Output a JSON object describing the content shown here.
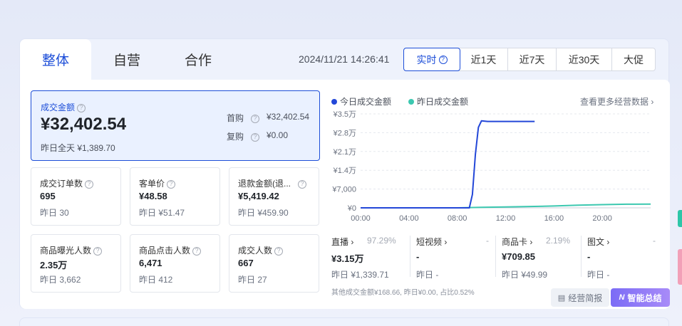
{
  "tabs": [
    {
      "label": "整体",
      "active": true
    },
    {
      "label": "自营",
      "active": false
    },
    {
      "label": "合作",
      "active": false
    }
  ],
  "datetime": "2024/11/21 14:26:41",
  "ranges": [
    {
      "label": "实时",
      "active": true,
      "help": true
    },
    {
      "label": "近1天"
    },
    {
      "label": "近7天"
    },
    {
      "label": "近30天"
    },
    {
      "label": "大促"
    }
  ],
  "main_card": {
    "title": "成交金额",
    "value": "¥32,402.54",
    "yesterday": "昨日全天 ¥1,389.70",
    "first_label": "首购",
    "first_value": "¥32,402.54",
    "repeat_label": "复购",
    "repeat_value": "¥0.00"
  },
  "cards": [
    {
      "title": "成交订单数",
      "value": "695",
      "yesterday": "昨日 30"
    },
    {
      "title": "客单价",
      "value": "¥48.58",
      "yesterday": "昨日 ¥51.47"
    },
    {
      "title": "退款金额(退...",
      "value": "¥5,419.42",
      "yesterday": "昨日 ¥459.90"
    },
    {
      "title": "商品曝光人数",
      "value": "2.35万",
      "yesterday": "昨日 3,662"
    },
    {
      "title": "商品点击人数",
      "value": "6,471",
      "yesterday": "昨日 412"
    },
    {
      "title": "成交人数",
      "value": "667",
      "yesterday": "昨日 27"
    }
  ],
  "legend": {
    "today": "今日成交金额",
    "yesterday": "昨日成交金额"
  },
  "more_link": "查看更多经营数据 ›",
  "colors": {
    "primary": "#1d4ed8",
    "today_line": "#2347d8",
    "yesterday_line": "#3cc8b0",
    "ai_button": "#8b78f7"
  },
  "chart_data": {
    "type": "line",
    "x_ticks": [
      "00:00",
      "04:00",
      "08:00",
      "12:00",
      "16:00",
      "20:00"
    ],
    "y_ticks": [
      "¥0",
      "¥7,000",
      "¥1.4万",
      "¥2.1万",
      "¥2.8万",
      "¥3.5万"
    ],
    "ylim": [
      0,
      35000
    ],
    "xlim_hours": [
      0,
      24
    ],
    "grid": true,
    "legend_position": "top-left",
    "series": [
      {
        "name": "今日成交金额",
        "color": "#2347d8",
        "points": [
          [
            0,
            0
          ],
          [
            8,
            0
          ],
          [
            9,
            0
          ],
          [
            9.25,
            5000
          ],
          [
            9.5,
            20000
          ],
          [
            9.75,
            30000
          ],
          [
            10,
            32400
          ],
          [
            10.5,
            32200
          ],
          [
            14.4,
            32200
          ]
        ]
      },
      {
        "name": "昨日成交金额",
        "color": "#3cc8b0",
        "points": [
          [
            0,
            0
          ],
          [
            8,
            0
          ],
          [
            10,
            200
          ],
          [
            12,
            350
          ],
          [
            14,
            500
          ],
          [
            16,
            700
          ],
          [
            18,
            1000
          ],
          [
            20,
            1200
          ],
          [
            22,
            1350
          ],
          [
            24,
            1389
          ]
        ]
      }
    ]
  },
  "metrics": [
    {
      "name": "直播 ›",
      "pct": "97.29%",
      "value": "¥3.15万",
      "yesterday": "昨日 ¥1,339.71"
    },
    {
      "name": "短视频 ›",
      "pct": "-",
      "value": "-",
      "yesterday": "昨日 -"
    },
    {
      "name": "商品卡 ›",
      "pct": "2.19%",
      "value": "¥709.85",
      "yesterday": "昨日 ¥49.99"
    },
    {
      "name": "图文 ›",
      "pct": "-",
      "value": "-",
      "yesterday": "昨日 -"
    }
  ],
  "footnote": "其他成交金额¥168.66, 昨日¥0.00, 占比0.52%",
  "buttons": {
    "brief": "经营简报",
    "ai": "智能总结"
  }
}
